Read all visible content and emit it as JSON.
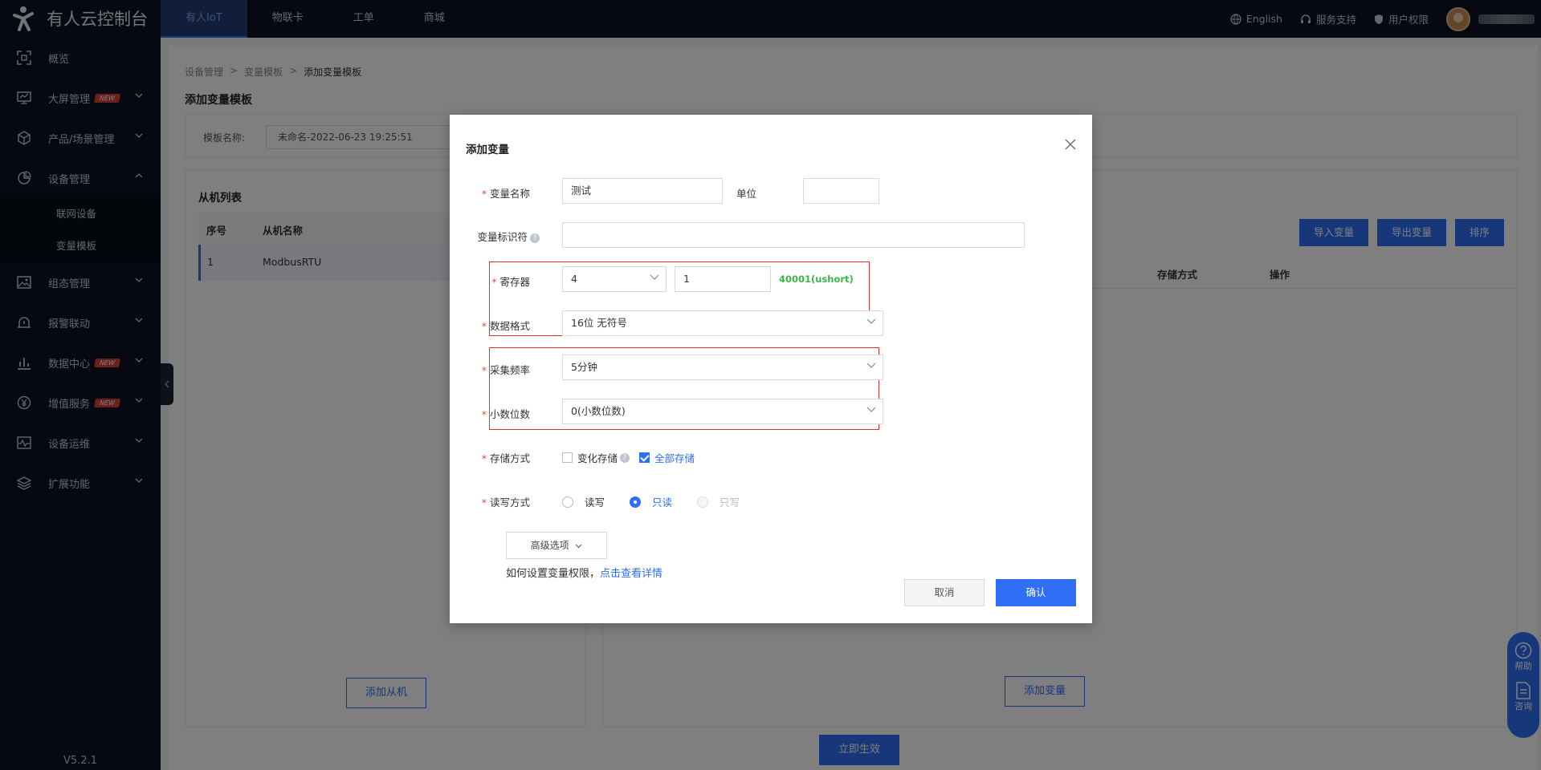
{
  "app": {
    "title": "有人云控制台"
  },
  "topnav": {
    "items": [
      "有人IoT",
      "物联卡",
      "工单",
      "商城"
    ]
  },
  "topright": {
    "language": "English",
    "support": "服务支持",
    "permission": "用户权限"
  },
  "sidebar": {
    "items": [
      {
        "label": "概览"
      },
      {
        "label": "大屏管理",
        "badge": "NEW"
      },
      {
        "label": "产品/场景管理"
      },
      {
        "label": "设备管理"
      },
      {
        "label": "组态管理"
      },
      {
        "label": "报警联动"
      },
      {
        "label": "数据中心",
        "badge": "NEW"
      },
      {
        "label": "增值服务",
        "badge": "NEW"
      },
      {
        "label": "设备运维"
      },
      {
        "label": "扩展功能"
      }
    ],
    "subitems": [
      "联网设备",
      "变量模板"
    ],
    "version": "V5.2.1"
  },
  "page": {
    "breadcrumb": [
      "设备管理",
      "变量模板",
      "添加变量模板"
    ],
    "title": "添加变量模板",
    "template_name_label": "模板名称:",
    "template_name_value": "未命名-2022-06-23 19:25:51",
    "slave_list_title": "从机列表",
    "slave_columns": [
      "序号",
      "从机名称"
    ],
    "slave_rows": [
      {
        "index": "1",
        "name": "ModbusRTU"
      }
    ],
    "add_slave": "添加从机",
    "var_buttons": [
      "导入变量",
      "导出变量",
      "排序"
    ],
    "var_columns": [
      "存储方式",
      "操作"
    ],
    "add_var": "添加变量",
    "apply": "立即生效"
  },
  "float_help": {
    "help": "帮助",
    "consult": "咨询"
  },
  "modal": {
    "title": "添加变量",
    "fields": {
      "var_name_label": "变量名称",
      "var_name_value": "测试",
      "unit_label": "单位",
      "unit_value": "",
      "identifier_label": "变量标识符",
      "identifier_value": "",
      "register_label": "寄存器",
      "register_type": "4",
      "register_addr": "1",
      "register_hint": "40001(ushort)",
      "data_format_label": "数据格式",
      "data_format_value": "16位 无符号",
      "freq_label": "采集频率",
      "freq_value": "5分钟",
      "decimal_label": "小数位数",
      "decimal_value": "0(小数位数)",
      "storage_label": "存储方式",
      "storage_options": [
        {
          "label": "变化存储",
          "checked": false
        },
        {
          "label": "全部存储",
          "checked": true
        }
      ],
      "rw_label": "读写方式",
      "rw_options": [
        {
          "label": "读写",
          "selected": false
        },
        {
          "label": "只读",
          "selected": true
        },
        {
          "label": "只写",
          "selected": false,
          "disabled": true
        }
      ]
    },
    "advanced": "高级选项",
    "how_text": "如何设置变量权限，",
    "how_link": "点击查看详情",
    "cancel": "取消",
    "ok": "确认"
  },
  "colors": {
    "primary": "#2f6ef7",
    "sidebar_bg": "#0c1322",
    "highlight_box": "#e0312f",
    "hint_green": "#3ab54a"
  }
}
